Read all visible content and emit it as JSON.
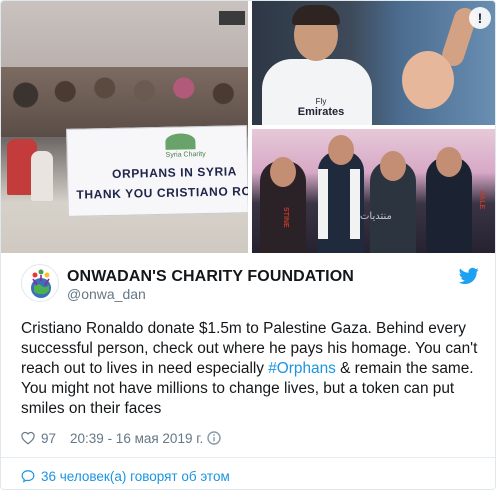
{
  "account": {
    "display_name": "ONWADAN'S CHARITY FOUNDATION",
    "handle": "@onwa_dan"
  },
  "media": {
    "banner_logo_text": "Syria Charity",
    "banner_line1": "ORPHANS IN SYRIA",
    "banner_line2": "THANK YOU CRISTIANO RO",
    "jersey_brand": "Fly",
    "jersey_sponsor": "Emirates",
    "scarf_text_left": "STINE",
    "scarf_text_right": "PALE",
    "watermark": "منتديات",
    "expand_icon": "!"
  },
  "tweet": {
    "text_before_hashtag": "Cristiano Ronaldo donate $1.5m to Palestine Gaza. Behind every successful person, check out where he pays his homage. You can't reach out to lives in need especially ",
    "hashtag": "#Orphans",
    "text_after_hashtag": " & remain the same. You might not have millions to change lives, but a token can put smiles on their faces"
  },
  "meta": {
    "likes": "97",
    "timestamp": "20:39 - 16 мая 2019 г."
  },
  "footer": {
    "talking_text": "36 человек(а) говорят об этом"
  },
  "icons": {
    "twitter": "twitter-bird-icon",
    "heart": "heart-icon",
    "reply": "speech-bubble-icon"
  },
  "colors": {
    "link_blue": "#1b95e0",
    "secondary_text": "#657786",
    "primary_text": "#14171a"
  }
}
